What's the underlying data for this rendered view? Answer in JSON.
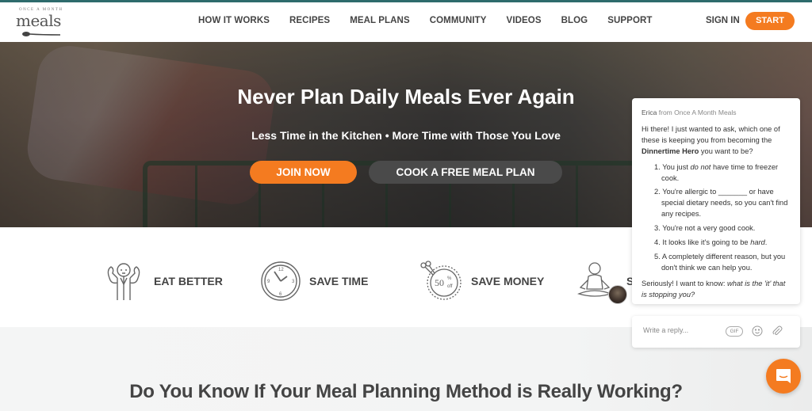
{
  "header": {
    "logo": {
      "top_text": "ONCE A MONTH",
      "main_text": "meals"
    },
    "nav": [
      "HOW IT WORKS",
      "RECIPES",
      "MEAL PLANS",
      "COMMUNITY",
      "VIDEOS",
      "BLOG",
      "SUPPORT"
    ],
    "sign_in": "SIGN IN",
    "start": "START"
  },
  "hero": {
    "title": "Never Plan Daily Meals Ever Again",
    "subtitle": "Less Time in the Kitchen • More Time with Those You Love",
    "join_button": "JOIN NOW",
    "cook_button": "COOK A FREE MEAL PLAN"
  },
  "benefits": [
    {
      "label": "EAT BETTER",
      "icon": "flexing-man-icon"
    },
    {
      "label": "SAVE TIME",
      "icon": "clock-icon"
    },
    {
      "label": "SAVE MONEY",
      "icon": "coupon-scissors-icon"
    },
    {
      "label": "S",
      "icon": "meditating-person-icon"
    }
  ],
  "section_heading": "Do You Know If Your Meal Planning Method is Really Working?",
  "chat": {
    "sender_name": "Erica",
    "sender_org": "from Once A Month Meals",
    "intro_before": "Hi there!  I just wanted to ask, which one of these is keeping you from becoming the ",
    "intro_bold": "Dinnertime Hero",
    "intro_after": " you want to be?",
    "options": [
      {
        "num": "1.",
        "before": "You just ",
        "em": "do not",
        "after": " have time to freezer cook."
      },
      {
        "num": "2.",
        "before": "You're allergic to _______ or have special dietary needs, so you can't find any recipes.",
        "em": "",
        "after": ""
      },
      {
        "num": "3.",
        "before": "You're not a very good cook.",
        "em": "",
        "after": ""
      },
      {
        "num": "4.",
        "before": "It looks like it's going to be ",
        "em": "hard",
        "after": "."
      },
      {
        "num": "5.",
        "before": " A completely different reason, but you don't think we can help you.",
        "em": "",
        "after": ""
      }
    ],
    "closing_before": "Seriously! I want to know: ",
    "closing_em": "what is the 'it' that is stopping you?",
    "reply_placeholder": "Write a reply...",
    "gif_label": "GIF"
  },
  "colors": {
    "accent": "#f47b20",
    "dark_button": "#4a4a4a",
    "top_stripe": "#2e6b6c",
    "text": "#444444"
  }
}
